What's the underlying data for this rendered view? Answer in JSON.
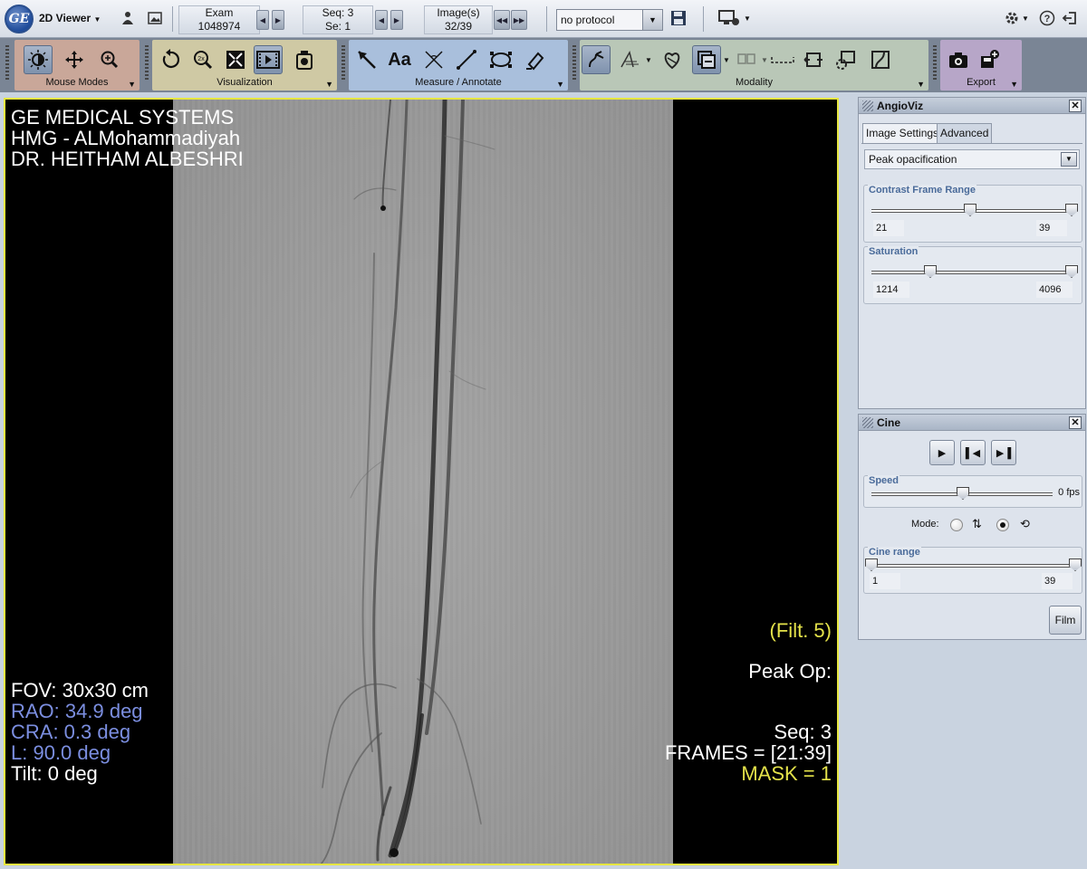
{
  "app": {
    "viewer_title": "2D Viewer",
    "logo_text": "GE"
  },
  "nav": {
    "exam_label": "Exam",
    "exam_value": "1048974",
    "seq_label": "Seq: 3",
    "se_label": "Se: 1",
    "images_label": "Image(s)",
    "images_value": "32/39"
  },
  "protocol": {
    "selected": "no protocol"
  },
  "toolbar": {
    "groups": {
      "mouse_modes": "Mouse Modes",
      "visualization": "Visualization",
      "measure": "Measure / Annotate",
      "modality": "Modality",
      "export": "Export"
    }
  },
  "overlay": {
    "institution_line1": "GE MEDICAL SYSTEMS",
    "institution_line2": "HMG - ALMohammadiyah",
    "physician": "DR. HEITHAM ALBESHRI",
    "fov": "FOV: 30x30 cm",
    "rao": "RAO: 34.9 deg",
    "cra": "CRA: 0.3 deg",
    "l": "L: 90.0 deg",
    "tilt": "Tilt: 0 deg",
    "filter": "(Filt. 5)",
    "peak_op": "Peak Op:",
    "seq": "Seq: 3",
    "frames": "FRAMES = [21:39]",
    "mask": "MASK =  1"
  },
  "angioviz": {
    "title": "AngioViz",
    "tabs": [
      "Image Settings",
      "Advanced"
    ],
    "mode_selected": "Peak opacification",
    "contrast_frame_range": {
      "label": "Contrast Frame Range",
      "min": "21",
      "max": "39"
    },
    "saturation": {
      "label": "Saturation",
      "min": "1214",
      "max": "4096"
    }
  },
  "cine": {
    "title": "Cine",
    "speed": {
      "label": "Speed",
      "value": "0 fps"
    },
    "mode_label": "Mode:",
    "cine_range": {
      "label": "Cine range",
      "min": "1",
      "max": "39"
    },
    "film_button": "Film"
  },
  "colors": {
    "accent": "#e4e24a",
    "toolbar_bg": "#7a8595",
    "mouse_modes": "#c9a799",
    "visualization": "#cfc9a4",
    "measure": "#a9bfdc",
    "modality": "#b9c7b7",
    "export": "#b7a6c8"
  }
}
